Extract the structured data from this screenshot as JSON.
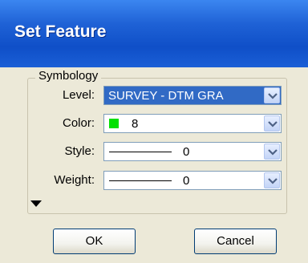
{
  "dialog": {
    "title": "Set Feature",
    "group_label": "Symbology",
    "fields": {
      "level": {
        "label": "Level:",
        "value": "SURVEY - DTM GRA"
      },
      "color": {
        "label": "Color:",
        "value": "8",
        "swatch_color": "#00e000"
      },
      "style": {
        "label": "Style:",
        "value": "0"
      },
      "weight": {
        "label": "Weight:",
        "value": "0"
      }
    },
    "buttons": {
      "ok": "OK",
      "cancel": "Cancel"
    },
    "icons": {
      "expander": "triangle-down-icon",
      "dropdown": "chevron-down-icon"
    },
    "colors": {
      "titlebar": "#0f4fc8",
      "selection": "#316ac5"
    }
  }
}
